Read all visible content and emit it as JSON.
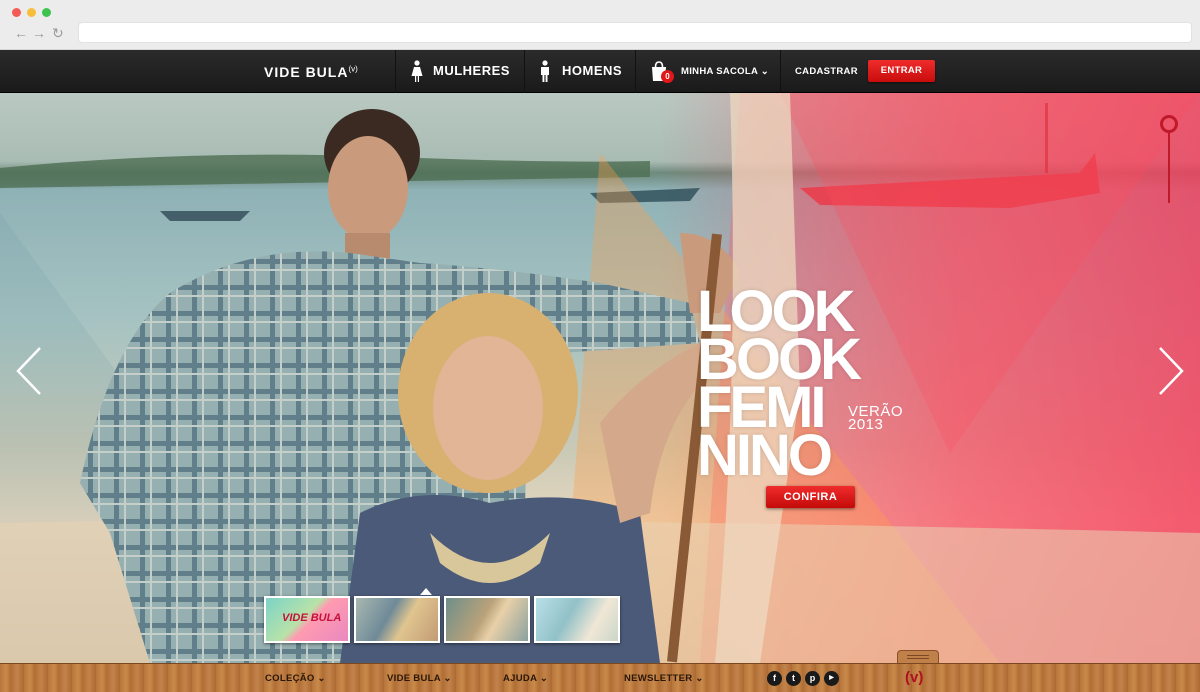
{
  "browser": {
    "back": "←",
    "forward": "→",
    "reload": "↻"
  },
  "header": {
    "logo": "VIDE BULA",
    "logo_mark": "(v)",
    "nav": [
      {
        "label": "MULHERES",
        "icon": "woman-icon"
      },
      {
        "label": "HOMENS",
        "icon": "man-icon"
      }
    ],
    "bag": {
      "label": "MINHA SACOLA ⌄",
      "count": "0",
      "icon": "shopping-bag-icon"
    },
    "register": "CADASTRAR",
    "login": "ENTRAR"
  },
  "hero": {
    "title_lines": [
      "LOOK",
      "BOOK",
      "FEMI",
      "NINO"
    ],
    "season": "VERÃO",
    "year": "2013",
    "cta": "CONFIRA",
    "thumbs": [
      {
        "label": "VIDE BULA"
      },
      {
        "label": ""
      },
      {
        "label": ""
      },
      {
        "label": ""
      }
    ]
  },
  "footer": {
    "links": [
      "COLEÇÃO ⌄",
      "VIDE BULA ⌄",
      "AJUDA ⌄",
      "NEWSLETTER ⌄"
    ],
    "social": [
      {
        "glyph": "f",
        "icon": "facebook-icon"
      },
      {
        "glyph": "t",
        "icon": "twitter-icon"
      },
      {
        "glyph": "p",
        "icon": "pinterest-icon"
      },
      {
        "glyph": "▶",
        "icon": "youtube-icon"
      }
    ],
    "logo": "(v)"
  },
  "colors": {
    "accent_red": "#e01818",
    "header_bg": "#1f1f1f",
    "footer_wood": "#b87740"
  }
}
